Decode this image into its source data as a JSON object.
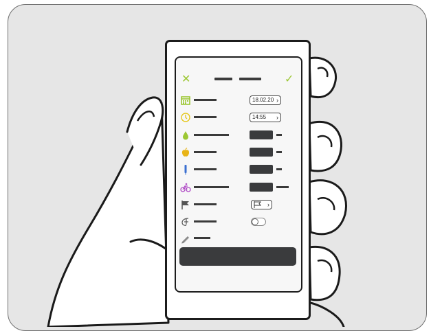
{
  "colors": {
    "accent": "#9cc733",
    "calendar": "#9cc733",
    "clock": "#e6c81e",
    "drop": "#9cc733",
    "apple": "#e8b418",
    "syringe": "#3a6fd1",
    "bike": "#b04cc6",
    "dark": "#3a3b3d"
  },
  "header": {
    "close_icon": "close-icon",
    "confirm_icon": "check-icon"
  },
  "rows": [
    {
      "icon": "calendar-icon",
      "value": "18.02.20"
    },
    {
      "icon": "clock-icon",
      "value": "14:55"
    },
    {
      "icon": "blood-drop-icon"
    },
    {
      "icon": "apple-icon"
    },
    {
      "icon": "syringe-icon"
    },
    {
      "icon": "bike-icon"
    },
    {
      "icon": "flag-icon"
    },
    {
      "icon": "custom-icon",
      "toggle": "off"
    },
    {
      "icon": "pencil-icon"
    }
  ]
}
